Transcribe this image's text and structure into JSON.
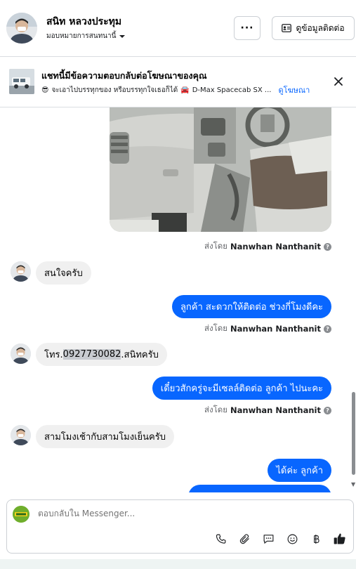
{
  "header": {
    "contact_name": "สนิท หลวงประทุม",
    "assign_label": "มอบหมายการสนทนานี้",
    "more_label": "···",
    "contact_info_label": "ดูข้อมูลติดต่อ"
  },
  "ad_banner": {
    "title": "แชทนี้มีข้อความตอบกลับต่อโฆษณาของคุณ",
    "emoji": "😎",
    "subtitle": "จะเอาไปบรรทุกของ หรือบรรทุกใจเธอก็ได้",
    "car_emoji": "🚘",
    "model": "D-Max Spacecab SX ...",
    "view_ad_label": "ดูโฆษณา"
  },
  "thread": {
    "sent_by_prefix": "ส่งโดย",
    "agent_name": "Nanwhan Nanthanit",
    "messages": [
      {
        "direction": "in",
        "text": "สนใจครับ"
      },
      {
        "direction": "out",
        "text": "ลูกค้า สะดวกให้ติดต่อ ช่วงกี่โมงดีคะ"
      },
      {
        "direction": "in",
        "prefix": "โทร.",
        "phone": "0927730082",
        "suffix": ".สนิทครับ"
      },
      {
        "direction": "out",
        "text": "เดี๋ยวสักครู่จะมีเซลล์ติดต่อ ลูกค้า ไปนะคะ"
      },
      {
        "direction": "in",
        "text": "สามโมงเช้ากับสามโมงเย็นครับ"
      },
      {
        "direction": "out",
        "text": "ได้ค่ะ  ลูกค้า"
      }
    ]
  },
  "composer": {
    "placeholder": "ตอบกลับใน Messenger..."
  },
  "colors": {
    "accent": "#0866ff",
    "incoming_bubble": "#f0f0f0",
    "muted_text": "#65676b"
  },
  "icons": [
    "chevron-down-icon",
    "contact-card-icon",
    "close-icon",
    "info-icon",
    "phone-icon",
    "attachment-icon",
    "saved-replies-icon",
    "emoji-icon",
    "baht-icon",
    "like-icon"
  ]
}
